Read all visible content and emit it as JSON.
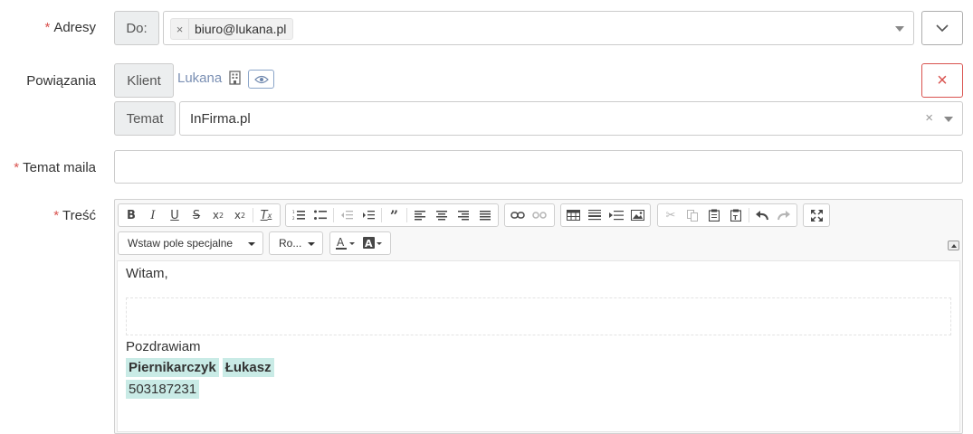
{
  "form": {
    "required_mark": "*",
    "adresy": {
      "label": "Adresy",
      "addon": "Do:",
      "tag_remove": "×",
      "tag_text": "biuro@lukana.pl"
    },
    "powiazania": {
      "label": "Powiązania",
      "klient_addon": "Klient",
      "klient_link": "Lukana",
      "remove": "×",
      "temat_addon": "Temat",
      "temat_value": "InFirma.pl",
      "temat_clear": "×"
    },
    "temat_maila": {
      "label": "Temat maila",
      "value": ""
    },
    "tresc": {
      "label": "Treść"
    }
  },
  "editor": {
    "special_field": "Wstaw pole specjalne",
    "font_combo": "Ro...",
    "content": {
      "greeting": "Witam,",
      "closing": "Pozdrawiam",
      "last_name": "Piernikarczyk",
      "first_name": "Łukasz",
      "phone": "503187231"
    }
  },
  "colors": {
    "required": "#d9534f",
    "link": "#7a8fb3",
    "danger": "#d9534f",
    "highlight": "#c9ebe6"
  }
}
